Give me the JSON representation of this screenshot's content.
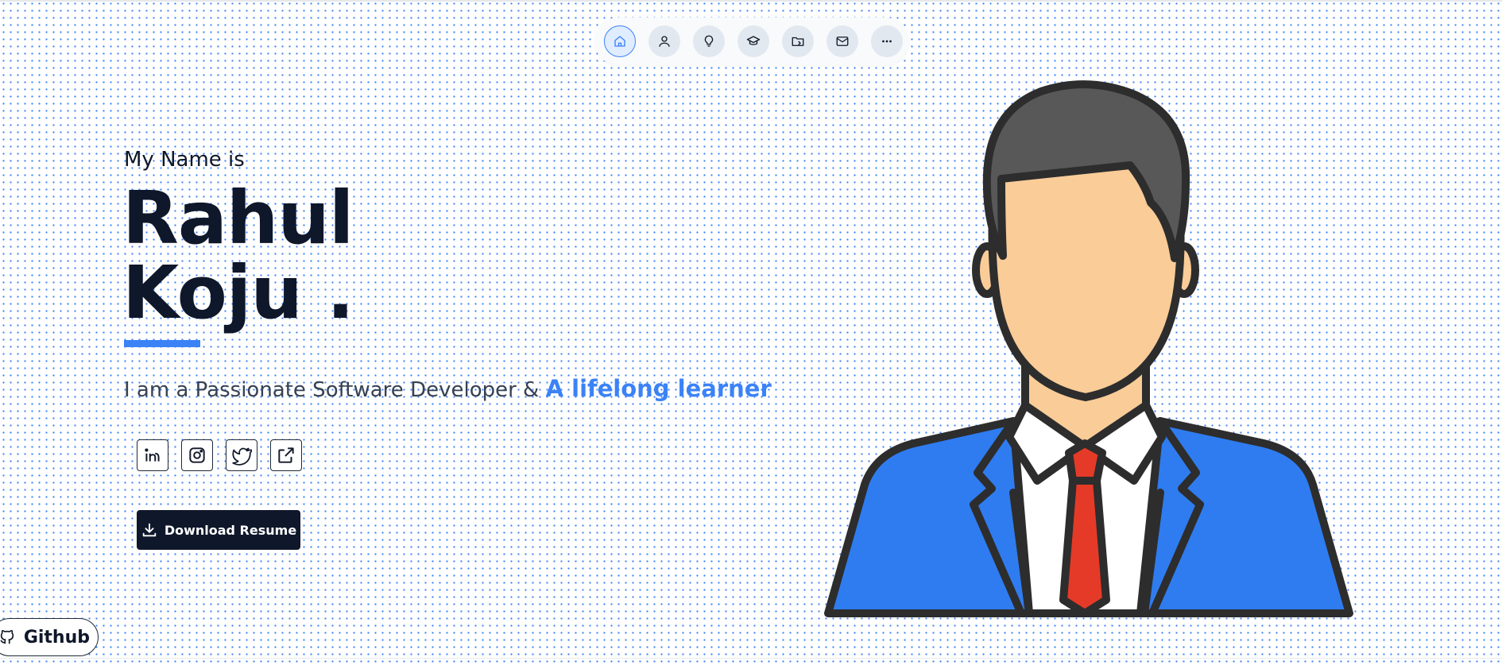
{
  "nav": {
    "items": [
      {
        "icon": "home-icon",
        "active": true
      },
      {
        "icon": "user-icon",
        "active": false
      },
      {
        "icon": "lightbulb-icon",
        "active": false
      },
      {
        "icon": "graduation-cap-icon",
        "active": false
      },
      {
        "icon": "folder-icon",
        "active": false
      },
      {
        "icon": "mail-icon",
        "active": false
      },
      {
        "icon": "more-icon",
        "active": false
      }
    ]
  },
  "hero": {
    "intro": "My Name is",
    "first_name": "Rahul",
    "last_name": "Koju .",
    "tagline_prefix": "I am a Passionate Software Developer & ",
    "tagline_accent": "A lifelong learner"
  },
  "social": {
    "items": [
      {
        "icon": "linkedin-icon"
      },
      {
        "icon": "instagram-icon"
      },
      {
        "icon": "twitter-icon"
      },
      {
        "icon": "external-link-icon"
      }
    ]
  },
  "download": {
    "label": "Download Resume",
    "icon": "download-icon"
  },
  "github": {
    "label": "Github",
    "icon": "github-icon"
  },
  "colors": {
    "accent": "#3b82f6",
    "dark": "#0f172a",
    "suit": "#2f7cf0",
    "tie": "#e53a28",
    "hair": "#585858",
    "skin": "#f9cc98"
  }
}
